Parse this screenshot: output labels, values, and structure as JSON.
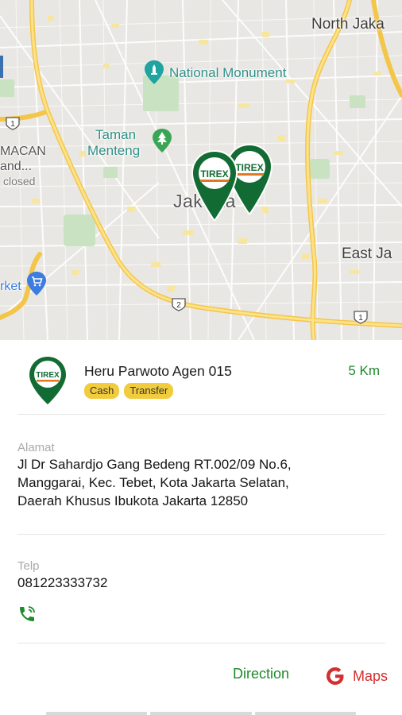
{
  "map": {
    "labels": {
      "north_jakarta": "North Jaka",
      "national_monument": "National Monument",
      "taman_menteng_line1": "Taman",
      "taman_menteng_line2": "Menteng",
      "macan_line1": "MACAN",
      "macan_line2": "and...",
      "macan_line3": "closed",
      "center_city": "Jakarta",
      "east_jakarta": "East Ja",
      "market": "rket"
    },
    "route_shields": [
      "1",
      "2",
      "1"
    ],
    "marker_logo_text": "TIREX",
    "colors": {
      "road_major": "#f6d66b",
      "road_minor": "#ffffff",
      "park": "#c9e3c2",
      "block": "#f6e9a6",
      "marker_green": "#136b34",
      "poi_teal": "#1fa4a0"
    }
  },
  "agent": {
    "name": "Heru Parwoto Agen 015",
    "distance": "5 Km",
    "logo_text": "TIREX",
    "tags": [
      "Cash",
      "Transfer"
    ]
  },
  "address": {
    "label": "Alamat",
    "line1": "Jl Dr Sahardjo Gang Bedeng RT.002/09 No.6,",
    "line2": "Manggarai, Kec. Tebet, Kota Jakarta Selatan,",
    "line3": "Daerah Khusus Ibukota Jakarta 12850"
  },
  "phone": {
    "label": "Telp",
    "value": "081223333732",
    "icon": "phone-call-icon"
  },
  "actions": {
    "direction_label": "Direction",
    "maps_label": "Maps",
    "maps_icon": "google-g-icon"
  },
  "theme": {
    "accent_green": "#1f8a2c",
    "tag_yellow": "#f2cc3c",
    "maps_red": "#d32f2f"
  }
}
